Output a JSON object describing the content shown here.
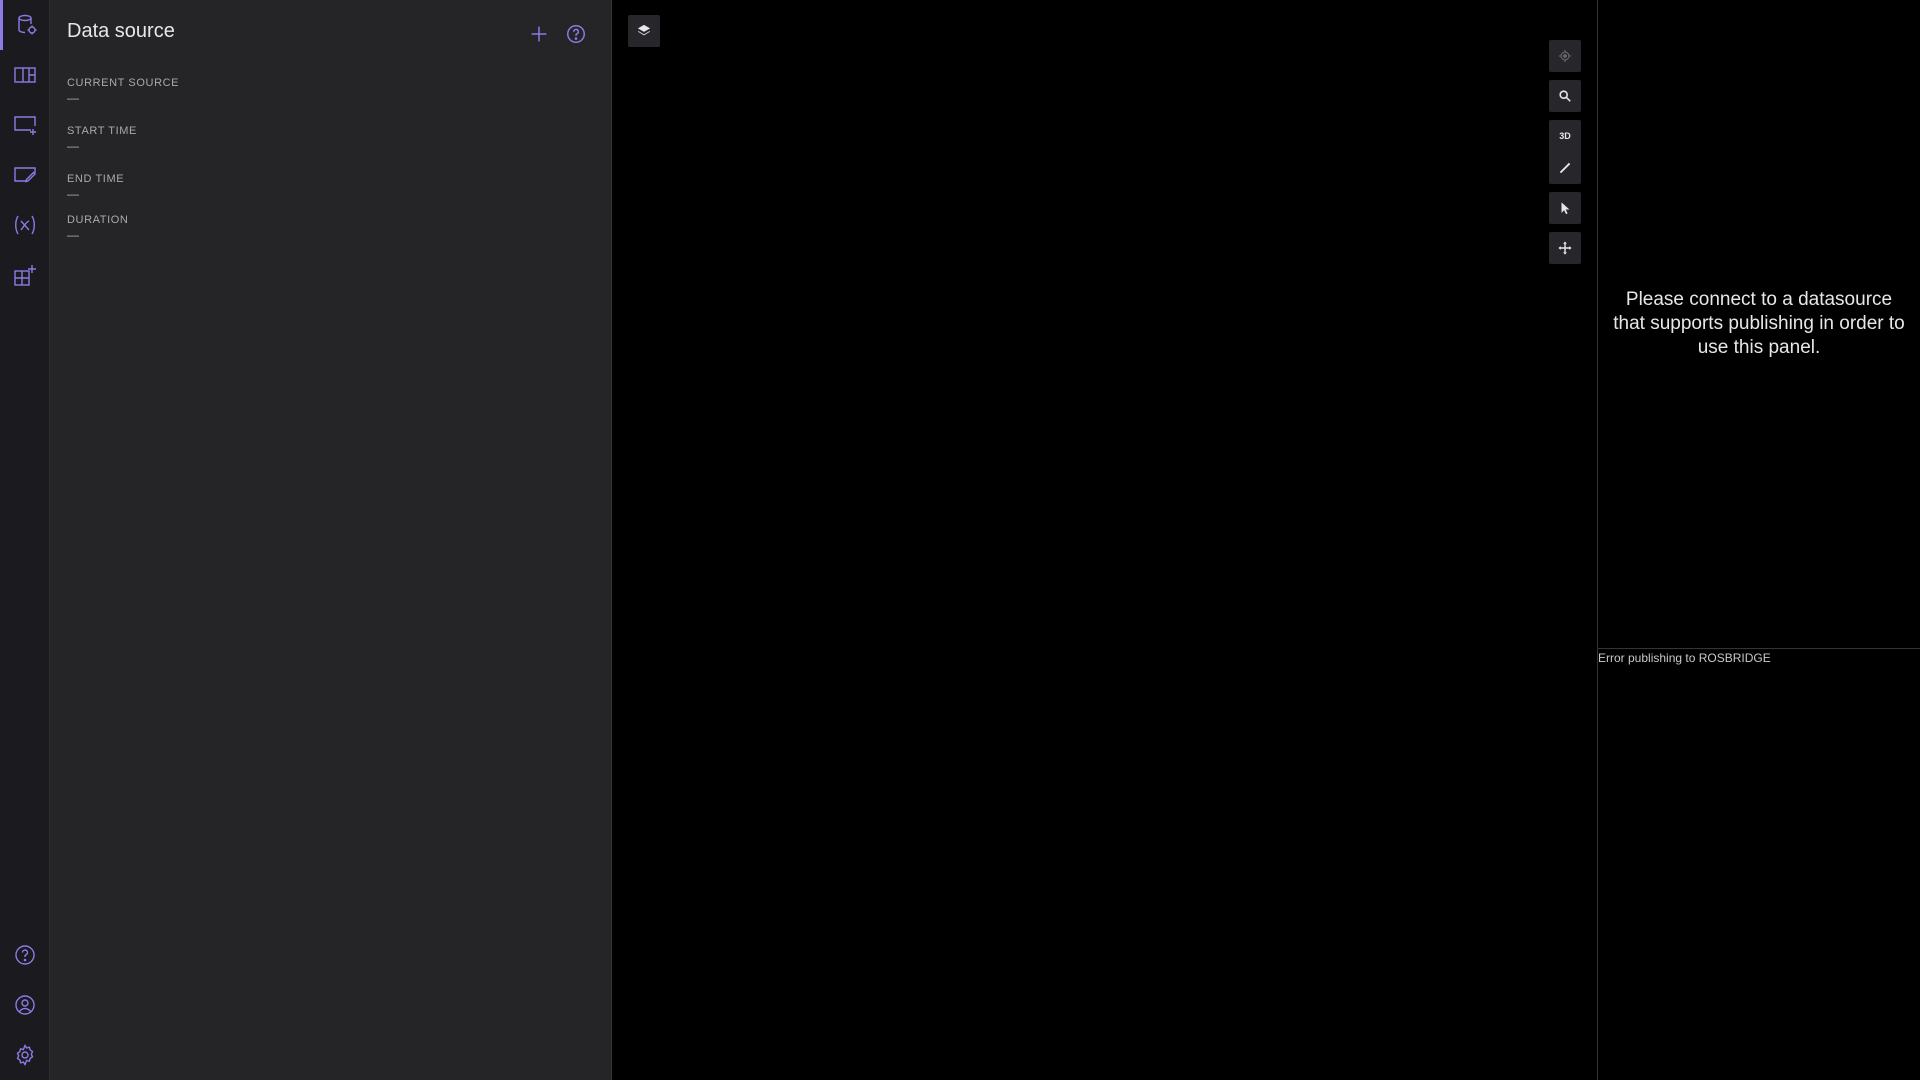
{
  "sidebar": {
    "title": "Data source",
    "fields": [
      {
        "label": "CURRENT SOURCE",
        "value": "—"
      },
      {
        "label": "START TIME",
        "value": "—"
      },
      {
        "label": "END TIME",
        "value": "—"
      },
      {
        "label": "DURATION",
        "value": "—"
      }
    ]
  },
  "iconbar": {
    "top": [
      "data-source-icon",
      "panels-icon",
      "add-panel-icon",
      "annotate-icon",
      "variables-icon",
      "extensions-icon"
    ],
    "bottom": [
      "help-icon",
      "account-icon",
      "settings-icon"
    ]
  },
  "viewport": {
    "three_d_label": "3D",
    "tools": [
      "layers-icon",
      "recenter-icon",
      "search-icon",
      "measure-icon",
      "select-icon",
      "move-icon"
    ]
  },
  "publish_panel": {
    "message": "Please connect to a datasource that supports publishing in order to use this panel."
  },
  "status": {
    "error_text": "Error publishing to ROSBRIDGE"
  },
  "colors": {
    "accent": "#8c7ae6",
    "sidebar_bg": "#252528",
    "iconbar_bg": "#1a1a1f"
  }
}
